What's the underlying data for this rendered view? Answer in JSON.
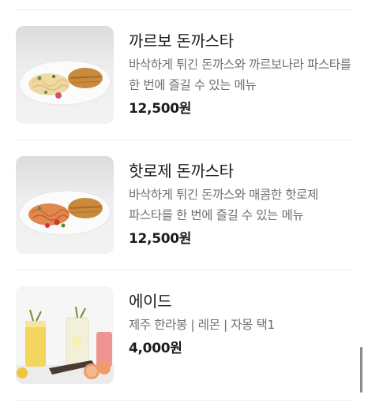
{
  "menu": {
    "items": [
      {
        "name": "까르보 돈까스타",
        "description": "바삭하게 튀긴 돈까스와 까르보나라 파스타를 한 번에 즐길 수 있는 메뉴",
        "price": "12,500원",
        "image_icon": "carbonara-tonkatsu-photo"
      },
      {
        "name": "핫로제 돈까스타",
        "description": "바삭하게 튀긴 돈까스와 매콤한 핫로제 파스타를 한 번에 즐길 수 있는 메뉴",
        "price": "12,500원",
        "image_icon": "hot-rose-tonkatsu-photo"
      },
      {
        "name": "에이드",
        "description": "제주 한라봉 | 레몬 | 자몽 택1",
        "price": "4,000원",
        "image_icon": "ade-drinks-photo"
      }
    ]
  },
  "colors": {
    "divider": "#eeeeee",
    "text_primary": "#1b1b1b",
    "text_secondary": "#6f6f6f"
  }
}
